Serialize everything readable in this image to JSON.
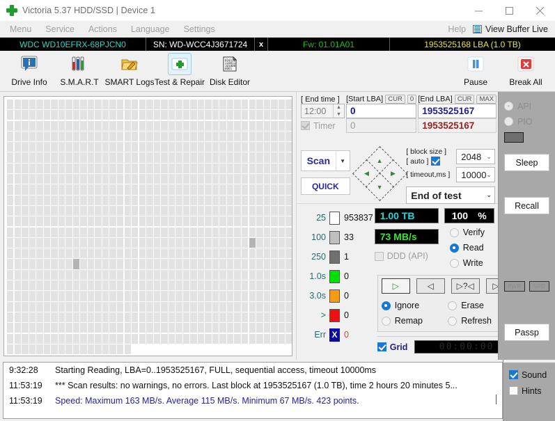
{
  "window": {
    "title": "Victoria 5.37 HDD/SSD | Device 1",
    "minimize": "–",
    "maximize": "□",
    "close": "✕"
  },
  "menu": {
    "items": [
      "Menu",
      "Service",
      "Actions",
      "Language",
      "Settings"
    ],
    "help": "Help",
    "view_buffer": "View Buffer Live"
  },
  "drive_strip": {
    "model": "WDC WD10EFRX-68PJCN0",
    "serial": "SN: WD-WCC4J3671724",
    "close_mark": "x",
    "firmware": "Fw: 01.01A01",
    "capacity": "1953525168 LBA (1.0 TB)"
  },
  "toolbar": {
    "left": [
      {
        "label": "Drive Info",
        "icon": "info-icon",
        "active": false
      },
      {
        "label": "S.M.A.R.T",
        "icon": "test-tubes-icon",
        "active": false
      },
      {
        "label": "SMART Logs",
        "icon": "folder-pencil-icon",
        "active": false
      },
      {
        "label": "Test & Repair",
        "icon": "green-cross-icon",
        "active": true
      },
      {
        "label": "Disk Editor",
        "icon": "binary-page-icon",
        "active": false
      }
    ],
    "right": [
      {
        "label": "Pause",
        "icon": "pause-icon"
      },
      {
        "label": "Break All",
        "icon": "red-x-icon"
      }
    ]
  },
  "params": {
    "end_time_label": "[ End time ]",
    "end_time_value": "12:00",
    "timer_label": "Timer",
    "timer_checked": true,
    "start_lba_label": "[Start LBA]",
    "start_lba_cur": "CUR",
    "start_lba_cur_value": "0",
    "start_lba_value": "0",
    "start_lba_second": "0",
    "end_lba_label": "[End LBA]",
    "end_lba_cur": "CUR",
    "end_lba_max": "MAX",
    "end_lba_value": "1953525167",
    "end_lba_second": "1953525167"
  },
  "actions": {
    "scan_label": "Scan",
    "scan_dropdown": "▼",
    "quick_label": "QUICK",
    "dpad": {
      "up": "▲",
      "left": "◀",
      "right": "▶",
      "down": "▼"
    }
  },
  "options": {
    "block_size_label": "[ block size ]",
    "block_size_value": "2048",
    "auto_label": "[ auto ]",
    "auto_checked": true,
    "timeout_label": "[ timeout,ms ]",
    "timeout_value": "10000",
    "end_action_value": "End of test"
  },
  "legend": [
    {
      "threshold": "25",
      "color": "#ffffff",
      "count": "953837"
    },
    {
      "threshold": "100",
      "color": "#bfbfbf",
      "count": "33"
    },
    {
      "threshold": "250",
      "color": "#707070",
      "count": "1"
    },
    {
      "threshold": "1.0s",
      "color": "#00e000",
      "count": "0"
    },
    {
      "threshold": "3.0s",
      "color": "#f59b14",
      "count": "0"
    },
    {
      "threshold": ">",
      "color": "#ee1111",
      "count": "0"
    },
    {
      "threshold": "Err",
      "color": "#0a0aa5",
      "count": "0",
      "glyph": "X"
    }
  ],
  "metrics": {
    "capacity": "1.00 TB",
    "percent_value": "100",
    "percent_unit": "%",
    "speed": "73 MB/s",
    "ddd_label": "DDD (API)",
    "ddd_checked": false,
    "modes": [
      {
        "label": "Verify",
        "selected": false
      },
      {
        "label": "Read",
        "selected": true
      },
      {
        "label": "Write",
        "selected": false
      }
    ]
  },
  "transport": [
    {
      "name": "play-forward",
      "glyph": "▷"
    },
    {
      "name": "play-backward",
      "glyph": "◁"
    },
    {
      "name": "random-access",
      "glyph": "▷?◁"
    },
    {
      "name": "butterfly",
      "glyph": "▷|◁"
    }
  ],
  "defects": [
    {
      "label": "Ignore",
      "selected": true
    },
    {
      "label": "Erase",
      "selected": false
    },
    {
      "label": "Remap",
      "selected": false
    },
    {
      "label": "Refresh",
      "selected": false
    }
  ],
  "grid_toggle": {
    "label": "Grid",
    "checked": true,
    "clock": "00:00:00"
  },
  "side_column": {
    "api_label": "API",
    "api_selected": true,
    "pio_label": "PIO",
    "pio_selected": false,
    "sleep_label": "Sleep",
    "recall_label": "Recall",
    "small_buttons": [
      "PWR",
      "SRD"
    ],
    "passp_label": "Passp"
  },
  "log": {
    "rows": [
      {
        "time": "9:32:28",
        "text": "Starting Reading, LBA=0..1953525167, FULL, sequential access, timeout 10000ms",
        "blue": false
      },
      {
        "time": "11:53:19",
        "text": "*** Scan results: no warnings, no errors. Last block at 1953525167 (1.0 TB), time 2 hours 20 minutes 5...",
        "blue": false
      },
      {
        "time": "11:53:19",
        "text": "Speed: Maximum 163 MB/s. Average 115 MB/s. Minimum 67 MB/s. 423 points.",
        "blue": true
      }
    ]
  },
  "footer_options": [
    {
      "label": "Sound",
      "checked": true
    },
    {
      "label": "Hints",
      "checked": false
    }
  ],
  "block_map": {
    "rows": 24,
    "cols": 42,
    "last_row_filled_cols": 17,
    "grey_cells": [
      [
        15,
        9
      ],
      [
        13,
        33
      ]
    ],
    "note": "Block surface map: light cells scanned fast, grey cells slower access"
  }
}
